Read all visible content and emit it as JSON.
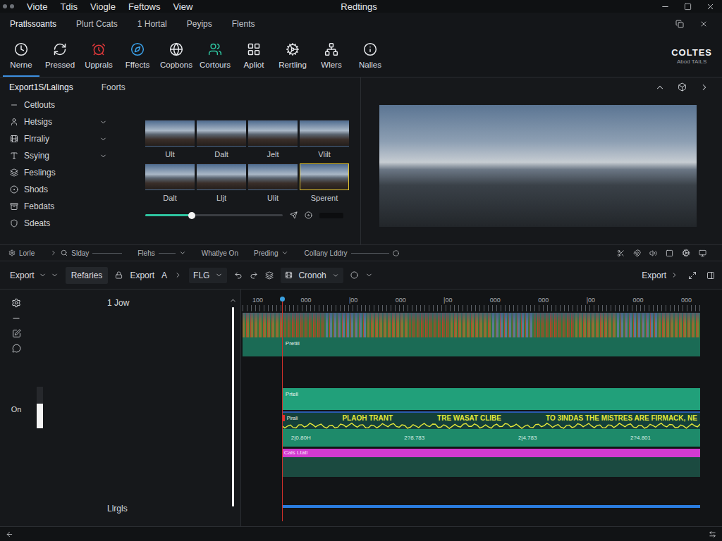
{
  "window": {
    "title": "Redtings",
    "menu": [
      "Viote",
      "Tdis",
      "Viogle",
      "Feftows",
      "View"
    ]
  },
  "tabs": [
    {
      "label": "Pratlssoants",
      "selected": true
    },
    {
      "label": "Plurt Ccats",
      "selected": false
    },
    {
      "label": "1 Hortal",
      "selected": false
    },
    {
      "label": "Peyips",
      "selected": false
    },
    {
      "label": "Flents",
      "selected": false
    }
  ],
  "toolbar": {
    "tools": [
      {
        "label": "Nerne",
        "selected": true,
        "color": "#e6e8eb"
      },
      {
        "label": "Pressed",
        "selected": false,
        "color": "#e6e8eb"
      },
      {
        "label": "Upprals",
        "selected": false,
        "color": "#e0383a"
      },
      {
        "label": "Fffects",
        "selected": false,
        "color": "#3aa0e8"
      },
      {
        "label": "Copbons",
        "selected": false,
        "color": "#e6e8eb"
      },
      {
        "label": "Cortours",
        "selected": false,
        "color": "#2ec4a0"
      },
      {
        "label": "Apliot",
        "selected": false,
        "color": "#e6e8eb"
      },
      {
        "label": "Rertling",
        "selected": false,
        "color": "#e6e8eb"
      },
      {
        "label": "Wlers",
        "selected": false,
        "color": "#e6e8eb"
      },
      {
        "label": "Nalles",
        "selected": false,
        "color": "#e6e8eb"
      }
    ],
    "brand": {
      "name": "COLTES",
      "tagline": "Abod TAILS"
    }
  },
  "browser": {
    "tabs": [
      {
        "label": "Export1S/Lalings",
        "selected": true
      },
      {
        "label": "Foorts",
        "selected": false
      }
    ],
    "sidebar": [
      {
        "label": "Cetlouts",
        "kind": "item"
      },
      {
        "label": "Hetsigs",
        "kind": "group"
      },
      {
        "label": "Flrraliy",
        "kind": "group"
      },
      {
        "label": "Ssying",
        "kind": "group"
      },
      {
        "label": "Feslings",
        "kind": "item"
      },
      {
        "label": "Shods",
        "kind": "item"
      },
      {
        "label": "Febdats",
        "kind": "item"
      },
      {
        "label": "Sdeats",
        "kind": "item"
      }
    ],
    "thumbnails": [
      {
        "label": "Ult",
        "selected": false
      },
      {
        "label": "Dalt",
        "selected": false
      },
      {
        "label": "Jelt",
        "selected": false
      },
      {
        "label": "Vlilt",
        "selected": false
      },
      {
        "label": "Dalt",
        "selected": false
      },
      {
        "label": "Lljt",
        "selected": false
      },
      {
        "label": "Ulit",
        "selected": false
      },
      {
        "label": "Sperent",
        "selected": true
      }
    ],
    "zoom": {
      "level": 0.34
    }
  },
  "filters": {
    "name": "Lorle",
    "search": "Slday",
    "filter": "Flehs",
    "toggle": "Whatlye On",
    "sort": "Preding",
    "range": "Collany Lddry"
  },
  "timeline_toolbar": {
    "menu": "Export",
    "button": "Refaries",
    "label": "Export",
    "font": "A",
    "format": "FLG",
    "view": "Cronoh",
    "export": "Export"
  },
  "track_header": {
    "name": "1 Jow",
    "meter_label": "On",
    "meter_level": 0.6,
    "footer": "Llrgls"
  },
  "timeline": {
    "ruler": [
      "100",
      "000",
      "|00",
      "000",
      "|00",
      "000",
      "000",
      "|00",
      "000",
      "000"
    ],
    "playhead": {
      "level": 0.086
    },
    "tracks": [
      {
        "kind": "video",
        "from_playhead": false,
        "clips": [
          {
            "color": "#8a7436"
          },
          {
            "color": "#7c5a30"
          },
          {
            "color": "#5d7a96"
          },
          {
            "color": "#8a7436"
          },
          {
            "color": "#7c5a30"
          },
          {
            "color": "#8a7436"
          },
          {
            "color": "#5d7a96"
          },
          {
            "color": "#7c5a30"
          },
          {
            "color": "#8a7436"
          },
          {
            "color": "#5d7a96"
          },
          {
            "color": "#8a7436"
          }
        ]
      },
      {
        "kind": "audio",
        "label": "Pretiil",
        "from_playhead": false
      },
      {
        "kind": "title",
        "label": "Prtell",
        "from_playhead": true
      },
      {
        "kind": "caption",
        "label": "Pirali",
        "captions": [
          "PLAOH TRANT",
          "TRE WASAT CLIBE",
          "TO 3INDAS THE MISTRES ARE FIRMACK, NE"
        ],
        "from_playhead": true
      },
      {
        "kind": "markers",
        "markers": [
          "2|0.80H",
          "2?8.783",
          "2|4.783",
          "2?4.801"
        ],
        "from_playhead": true
      },
      {
        "kind": "effect",
        "label": "Cals Ltatl",
        "from_playhead": true
      },
      {
        "kind": "fill",
        "from_playhead": true
      },
      {
        "kind": "line",
        "from_playhead": true
      }
    ]
  }
}
